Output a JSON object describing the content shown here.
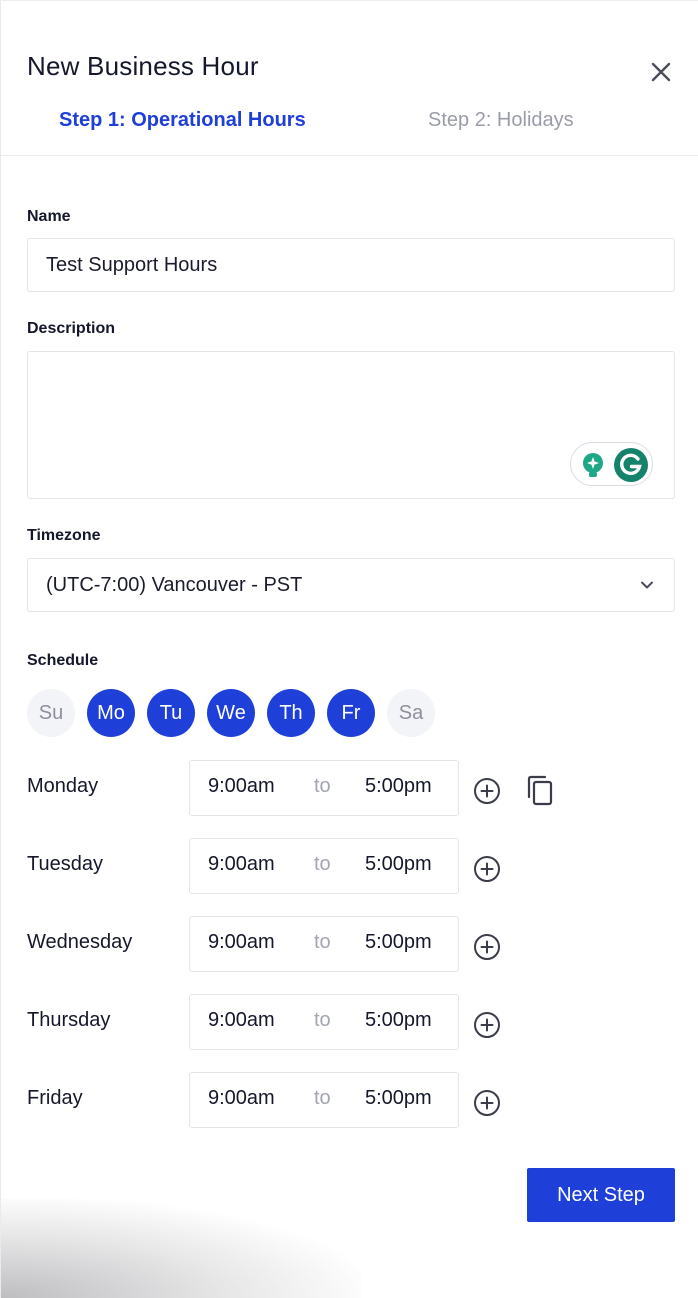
{
  "header": {
    "title": "New Business Hour",
    "tabs": [
      {
        "label": "Step 1: Operational Hours",
        "active": true
      },
      {
        "label": "Step 2: Holidays",
        "active": false
      }
    ],
    "close_icon": "close-icon"
  },
  "form": {
    "name_label": "Name",
    "name_value": "Test Support Hours",
    "description_label": "Description",
    "description_value": "",
    "timezone_label": "Timezone",
    "timezone_value": "(UTC-7:00) Vancouver - PST",
    "schedule_label": "Schedule",
    "days": [
      {
        "label": "Su",
        "selected": false
      },
      {
        "label": "Mo",
        "selected": true
      },
      {
        "label": "Tu",
        "selected": true
      },
      {
        "label": "We",
        "selected": true
      },
      {
        "label": "Th",
        "selected": true
      },
      {
        "label": "Fr",
        "selected": true
      },
      {
        "label": "Sa",
        "selected": false
      }
    ],
    "schedule_rows": [
      {
        "day": "Monday",
        "start": "9:00am",
        "separator": "to",
        "end": "5:00pm"
      },
      {
        "day": "Tuesday",
        "start": "9:00am",
        "separator": "to",
        "end": "5:00pm"
      },
      {
        "day": "Wednesday",
        "start": "9:00am",
        "separator": "to",
        "end": "5:00pm"
      },
      {
        "day": "Thursday",
        "start": "9:00am",
        "separator": "to",
        "end": "5:00pm"
      },
      {
        "day": "Friday",
        "start": "9:00am",
        "separator": "to",
        "end": "5:00pm"
      }
    ]
  },
  "footer": {
    "next_label": "Next Step"
  },
  "colors": {
    "accent": "#1f3fd9",
    "grammarly": "#15836b",
    "muted": "#9a9ca8"
  }
}
